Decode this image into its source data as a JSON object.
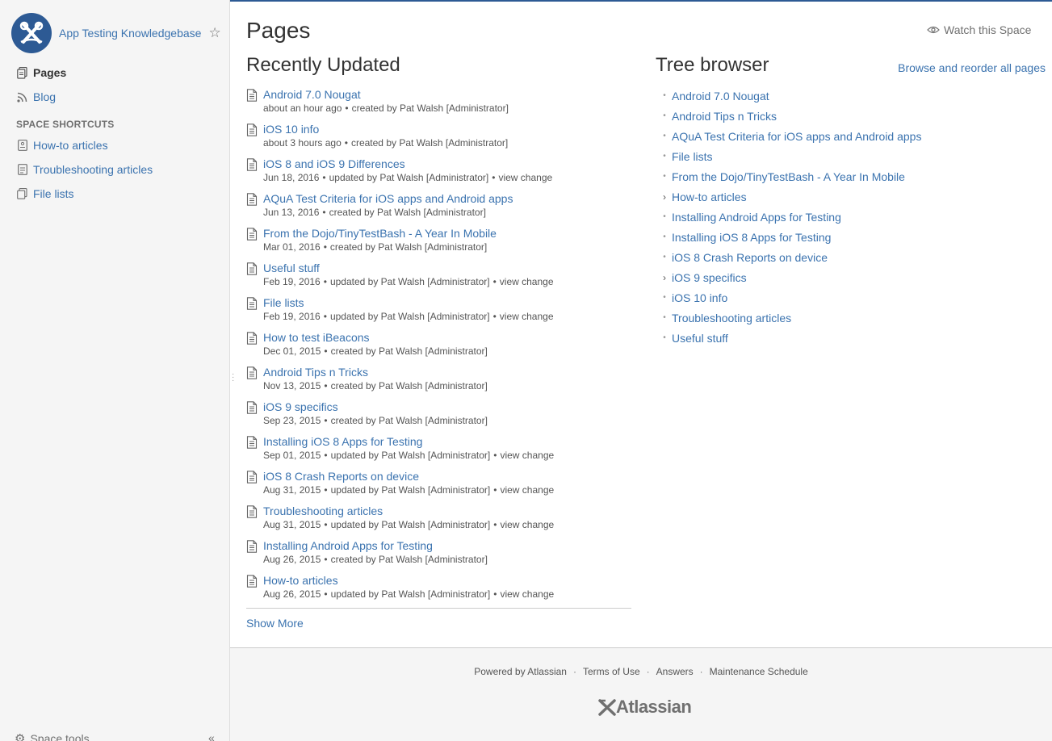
{
  "sidebar": {
    "space_name": "App Testing Knowledgebase",
    "nav": [
      {
        "label": "Pages",
        "icon": "pages-icon",
        "active": true
      },
      {
        "label": "Blog",
        "icon": "rss-icon",
        "active": false
      }
    ],
    "shortcuts_heading": "SPACE SHORTCUTS",
    "shortcuts": [
      {
        "label": "How-to articles",
        "icon": "howto-icon"
      },
      {
        "label": "Troubleshooting articles",
        "icon": "troubleshooting-icon"
      },
      {
        "label": "File lists",
        "icon": "file-lists-icon"
      }
    ],
    "space_tools": "Space tools",
    "collapse": "«"
  },
  "main": {
    "title": "Pages",
    "watch_label": "Watch this Space",
    "recent": {
      "heading": "Recently Updated",
      "items": [
        {
          "title": "Android 7.0 Nougat",
          "date": "about an hour ago",
          "action": "created by Pat Walsh [Administrator]",
          "view_change": ""
        },
        {
          "title": "iOS 10 info",
          "date": "about 3 hours ago",
          "action": "created by Pat Walsh [Administrator]",
          "view_change": ""
        },
        {
          "title": "iOS 8 and iOS 9 Differences",
          "date": "Jun 18, 2016",
          "action": "updated by Pat Walsh [Administrator]",
          "view_change": "view change"
        },
        {
          "title": "AQuA Test Criteria for iOS apps and Android apps",
          "date": "Jun 13, 2016",
          "action": "created by Pat Walsh [Administrator]",
          "view_change": ""
        },
        {
          "title": "From the Dojo/TinyTestBash - A Year In Mobile",
          "date": "Mar 01, 2016",
          "action": "created by Pat Walsh [Administrator]",
          "view_change": ""
        },
        {
          "title": "Useful stuff",
          "date": "Feb 19, 2016",
          "action": "updated by Pat Walsh [Administrator]",
          "view_change": "view change"
        },
        {
          "title": "File lists",
          "date": "Feb 19, 2016",
          "action": "updated by Pat Walsh [Administrator]",
          "view_change": "view change"
        },
        {
          "title": "How to test iBeacons",
          "date": "Dec 01, 2015",
          "action": "created by Pat Walsh [Administrator]",
          "view_change": ""
        },
        {
          "title": "Android Tips n Tricks",
          "date": "Nov 13, 2015",
          "action": "created by Pat Walsh [Administrator]",
          "view_change": ""
        },
        {
          "title": "iOS 9 specifics",
          "date": "Sep 23, 2015",
          "action": "created by Pat Walsh [Administrator]",
          "view_change": ""
        },
        {
          "title": "Installing iOS 8 Apps for Testing",
          "date": "Sep 01, 2015",
          "action": "updated by Pat Walsh [Administrator]",
          "view_change": "view change"
        },
        {
          "title": "iOS 8 Crash Reports on device",
          "date": "Aug 31, 2015",
          "action": "updated by Pat Walsh [Administrator]",
          "view_change": "view change"
        },
        {
          "title": "Troubleshooting articles",
          "date": "Aug 31, 2015",
          "action": "updated by Pat Walsh [Administrator]",
          "view_change": "view change"
        },
        {
          "title": "Installing Android Apps for Testing",
          "date": "Aug 26, 2015",
          "action": "created by Pat Walsh [Administrator]",
          "view_change": ""
        },
        {
          "title": "How-to articles",
          "date": "Aug 26, 2015",
          "action": "updated by Pat Walsh [Administrator]",
          "view_change": "view change"
        }
      ],
      "show_more": "Show More"
    },
    "tree": {
      "heading": "Tree browser",
      "browse_link": "Browse and reorder all pages",
      "items": [
        {
          "label": "Android 7.0 Nougat",
          "expandable": false
        },
        {
          "label": "Android Tips n Tricks",
          "expandable": false
        },
        {
          "label": "AQuA Test Criteria for iOS apps and Android apps",
          "expandable": false
        },
        {
          "label": "File lists",
          "expandable": false
        },
        {
          "label": "From the Dojo/TinyTestBash - A Year In Mobile",
          "expandable": false
        },
        {
          "label": "How-to articles",
          "expandable": true
        },
        {
          "label": "Installing Android Apps for Testing",
          "expandable": false
        },
        {
          "label": "Installing iOS 8 Apps for Testing",
          "expandable": false
        },
        {
          "label": "iOS 8 Crash Reports on device",
          "expandable": false
        },
        {
          "label": "iOS 9 specifics",
          "expandable": true
        },
        {
          "label": "iOS 10 info",
          "expandable": false
        },
        {
          "label": "Troubleshooting articles",
          "expandable": false
        },
        {
          "label": "Useful stuff",
          "expandable": false
        }
      ]
    }
  },
  "footer": {
    "links": [
      "Powered by Atlassian",
      "Terms of Use",
      "Answers",
      "Maintenance Schedule"
    ],
    "logo_text": "Atlassian"
  },
  "colors": {
    "link": "#3b73af",
    "brand": "#2d5a94",
    "sidebar_bg": "#f5f5f5"
  }
}
